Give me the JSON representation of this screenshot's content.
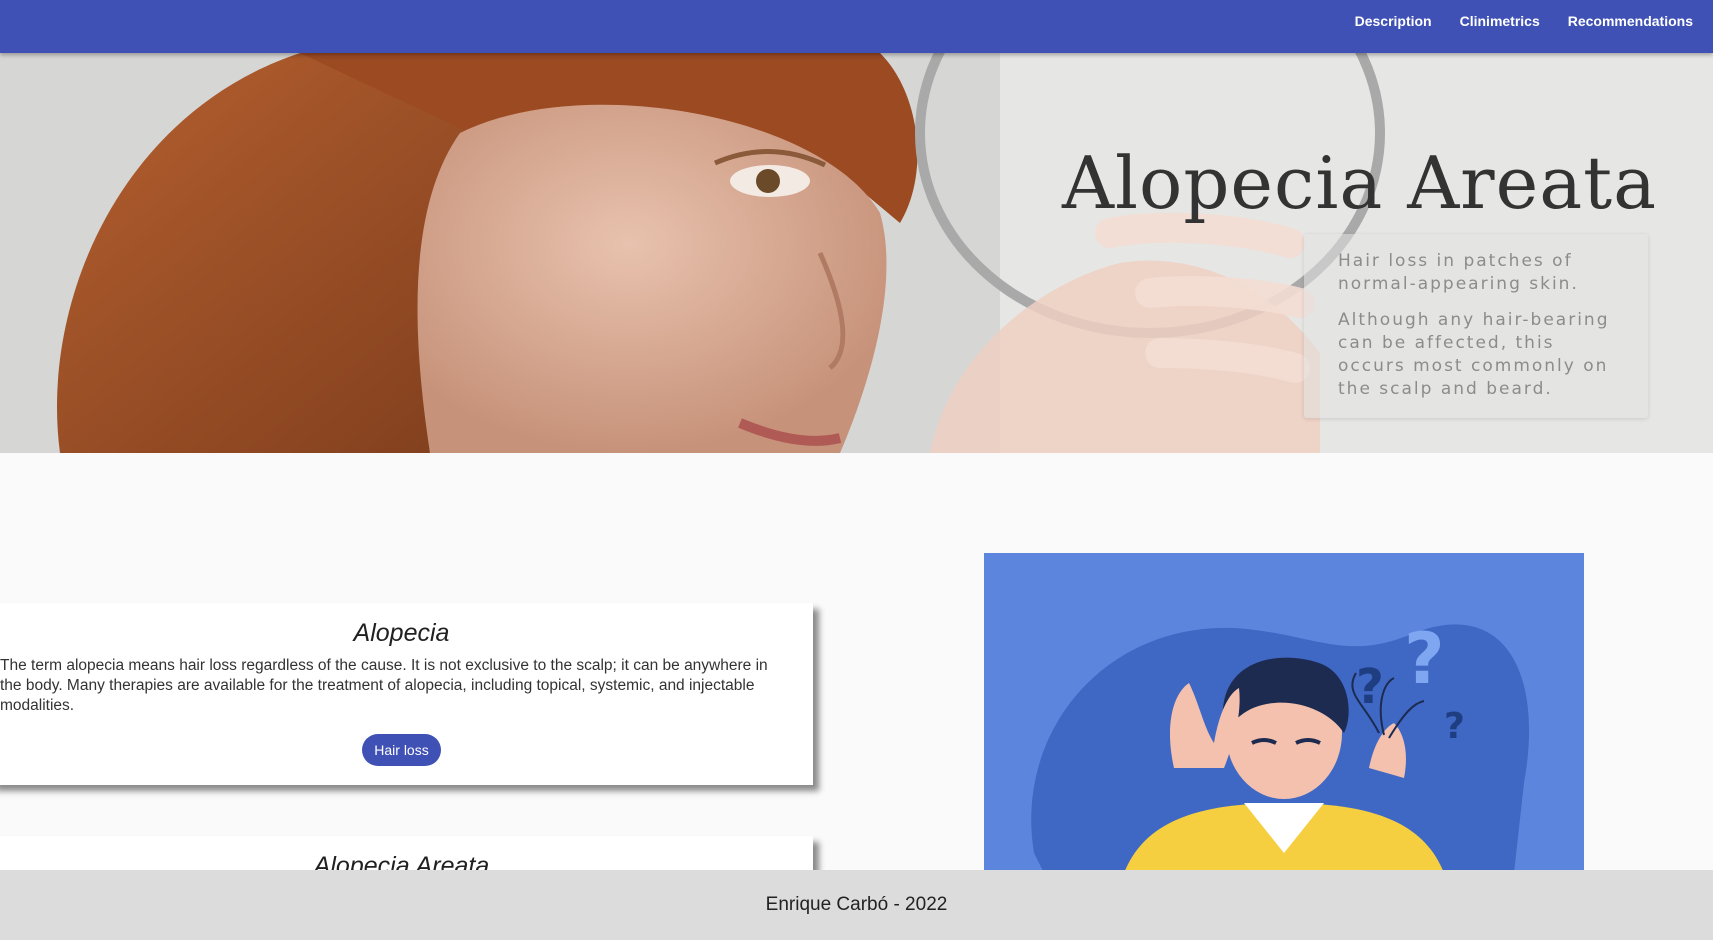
{
  "nav": {
    "links": [
      "Description",
      "Clinimetrics",
      "Recommendations"
    ]
  },
  "hero": {
    "title": "Alopecia Areata",
    "subtitle_1": "Hair loss in patches of normal-appearing skin.",
    "subtitle_2": "Although any hair-bearing can be affected, this occurs most commonly on the scalp and beard."
  },
  "cards": [
    {
      "title": "Alopecia",
      "text": "The term alopecia means hair loss regardless of the cause. It is not exclusive to the scalp; it can be anywhere in the body. Many therapies are available for the treatment of alopecia, including topical, systemic, and injectable modalities.",
      "button": "Hair loss"
    },
    {
      "title": "Alopecia Areata"
    }
  ],
  "footer": {
    "text": "Enrique Carbó - 2022"
  },
  "colors": {
    "primary": "#3f51b5",
    "illustration_bg": "#5c86de",
    "footer_bg": "#dcdcdc"
  }
}
